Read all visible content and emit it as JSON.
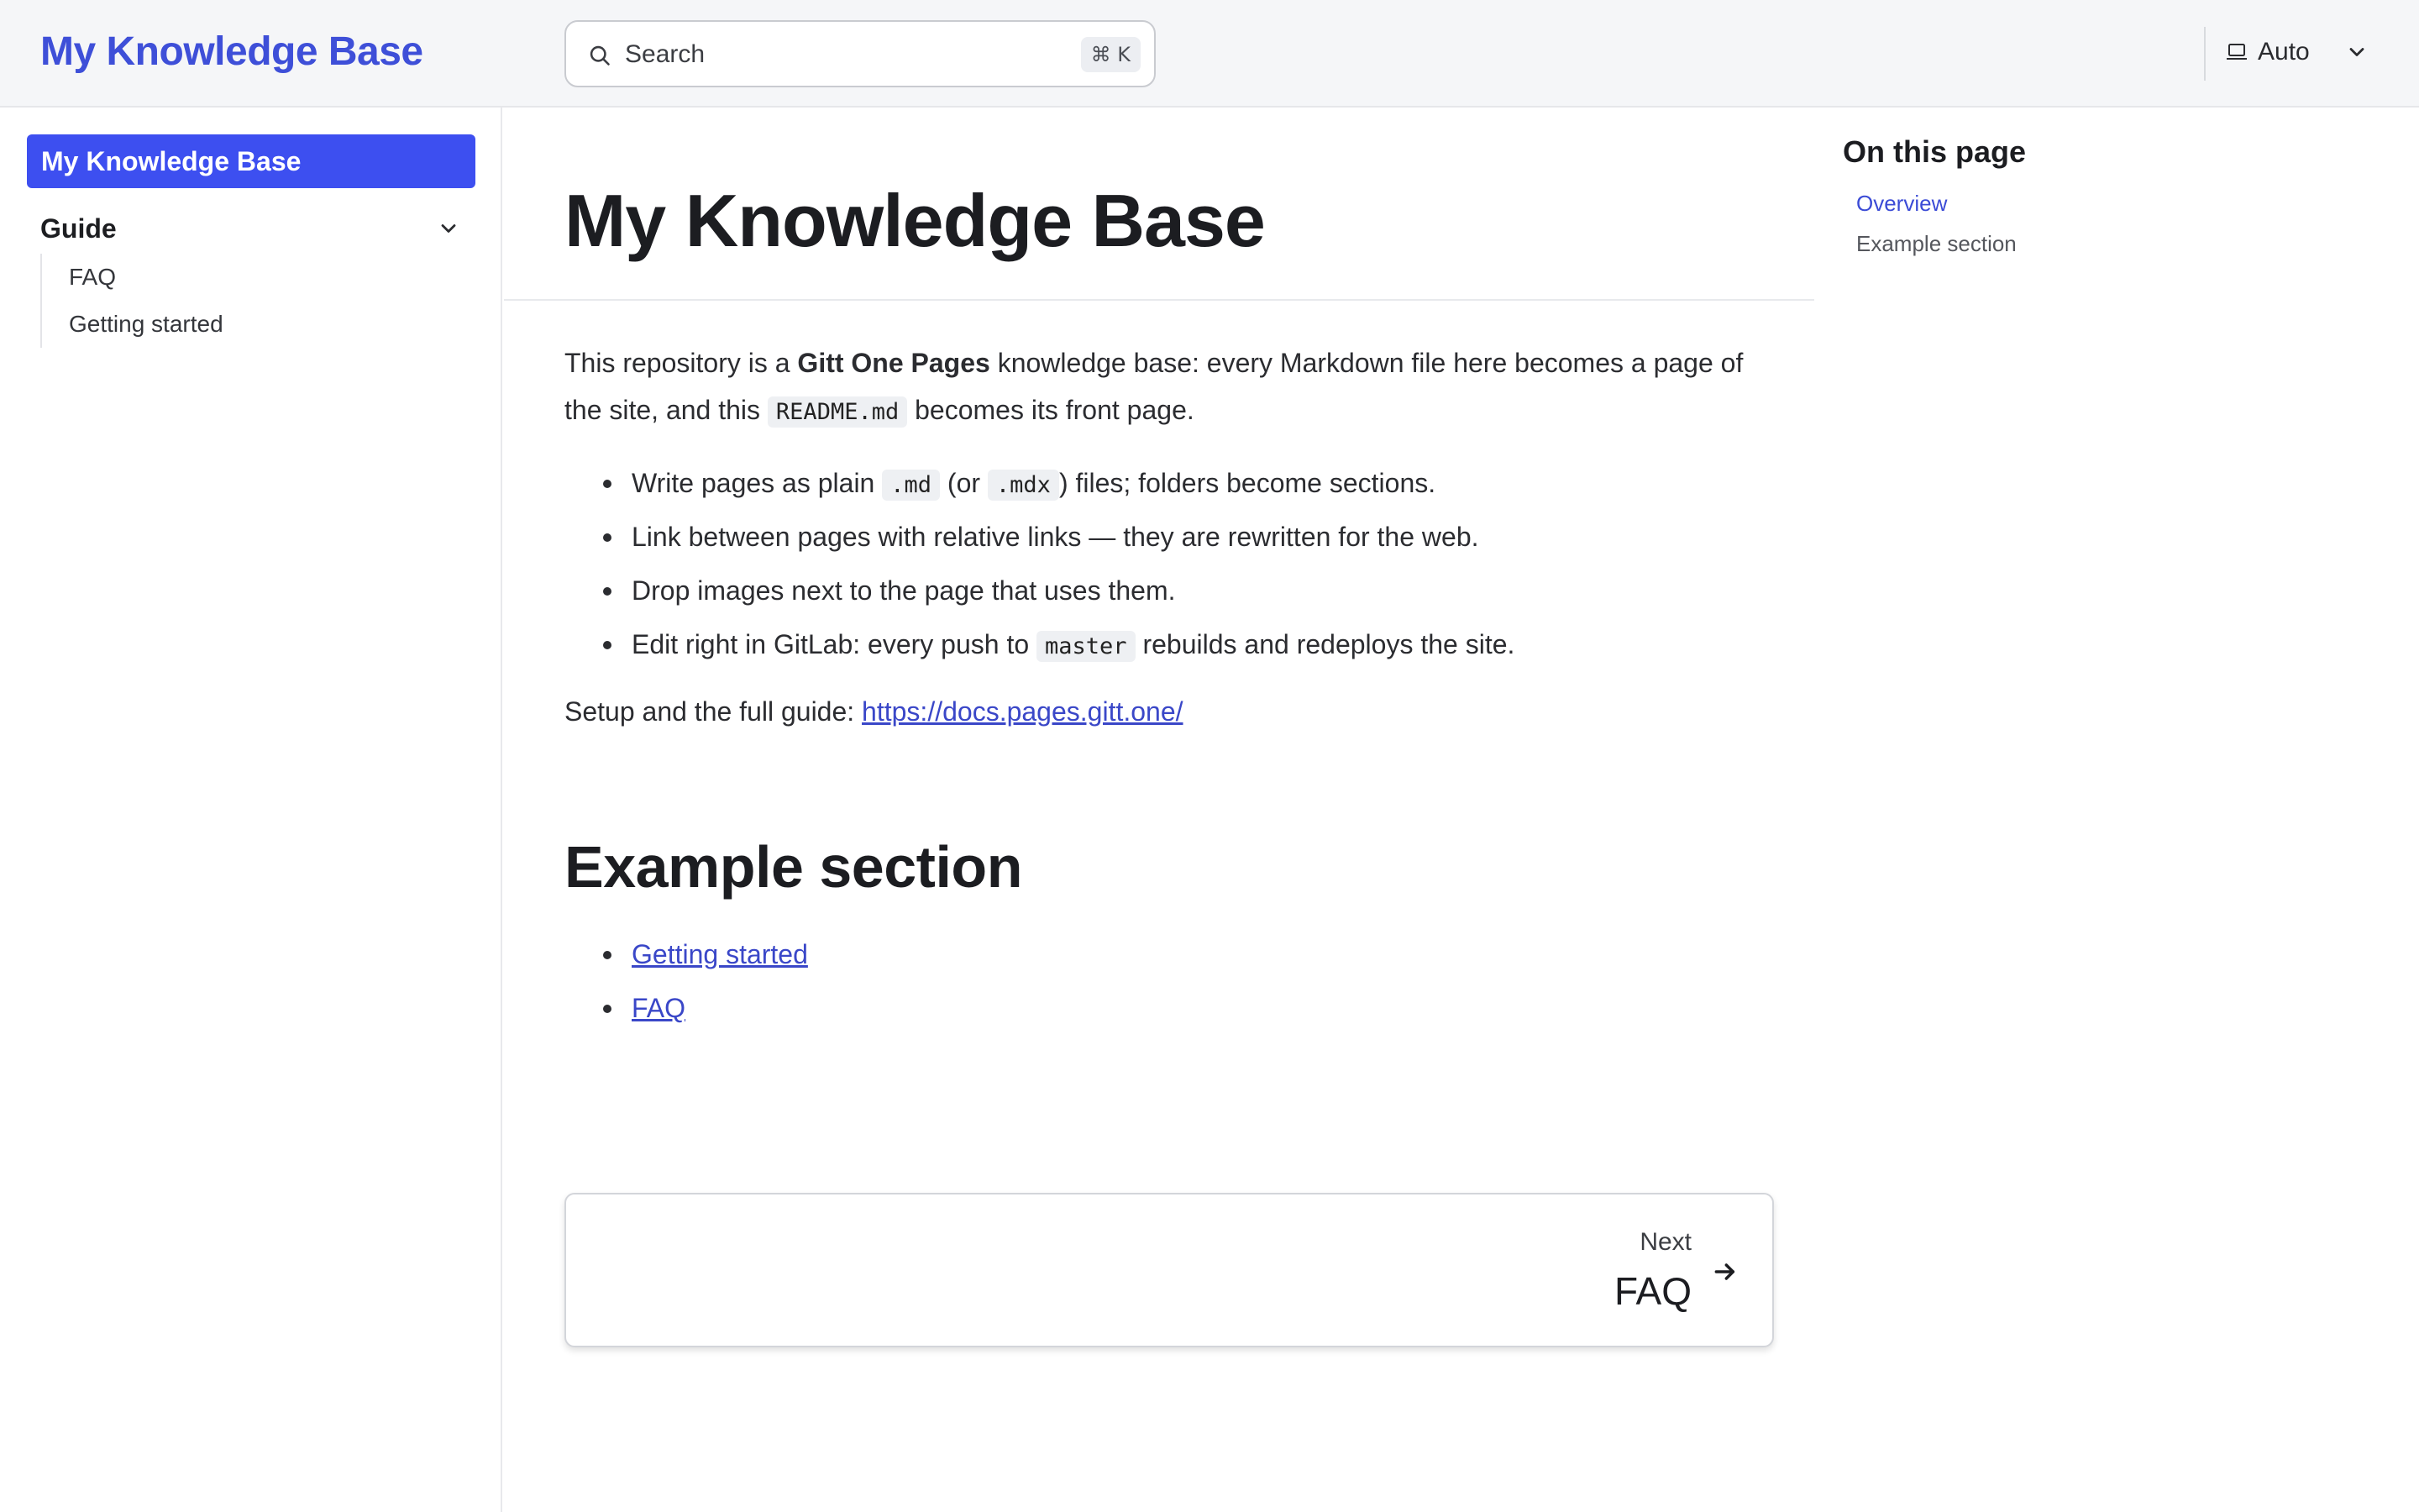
{
  "header": {
    "brand": "My Knowledge Base",
    "search_placeholder": "Search",
    "search_shortcut": "⌘ K",
    "theme_label": "Auto"
  },
  "sidebar": {
    "active_item": "My Knowledge Base",
    "group_label": "Guide",
    "items": [
      {
        "label": "FAQ"
      },
      {
        "label": "Getting started"
      }
    ]
  },
  "main": {
    "title": "My Knowledge Base",
    "intro": {
      "pre": "This repository is a ",
      "bold": "Gitt One Pages",
      "mid": " knowledge base: every Markdown file here becomes a page of the site, and this ",
      "code": "README.md",
      "post": " becomes its front page."
    },
    "bullets": [
      {
        "a": "Write pages as plain ",
        "code1": ".md",
        "b": " (or ",
        "code2": ".mdx",
        "c": ") files; folders become sections."
      },
      {
        "text": "Link between pages with relative links — they are rewritten for the web."
      },
      {
        "text": "Drop images next to the page that uses them."
      },
      {
        "a": "Edit right in GitLab: every push to ",
        "code": "master",
        "b": " rebuilds and redeploys the site."
      }
    ],
    "setup_text": "Setup and the full guide: ",
    "setup_link": "https://docs.pages.gitt.one/",
    "section_title": "Example section",
    "section_links": [
      "Getting started",
      "FAQ"
    ],
    "next_label": "Next",
    "next_title": "FAQ"
  },
  "toc": {
    "title": "On this page",
    "items": [
      {
        "label": "Overview",
        "active": true
      },
      {
        "label": "Example section",
        "active": false
      }
    ]
  },
  "colors": {
    "brand": "#3e4fd8",
    "active_bg": "#3d4ff0",
    "link": "#3a47c8"
  }
}
